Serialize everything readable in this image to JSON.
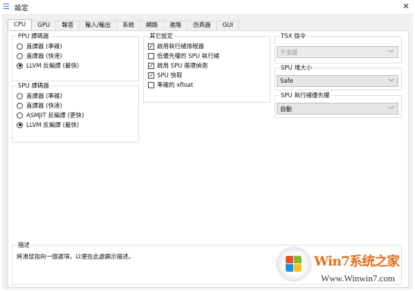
{
  "window": {
    "title": "設定",
    "close": "✕"
  },
  "tabs": [
    "CPU",
    "GPU",
    "聲音",
    "輸入/輸出",
    "系統",
    "網路",
    "進階",
    "仿真器",
    "GUI"
  ],
  "ppu": {
    "label": "PPU 譯碼器",
    "options": [
      "直譯器 (準確)",
      "直譯器 (快速)",
      "LLVM 反編譯 (最快)"
    ],
    "selected": 2
  },
  "spu": {
    "label": "SPU 譯碼器",
    "options": [
      "直譯器 (準確)",
      "直譯器 (快速)",
      "ASMJIT 反編譯 (更快)",
      "LLVM 反編譯 (最快)"
    ],
    "selected": 3
  },
  "other": {
    "label": "其它設定",
    "items": [
      {
        "label": "啟用執行緒排程器",
        "checked": true
      },
      {
        "label": "低優先權的 SPU 執行緒",
        "checked": false
      },
      {
        "label": "啟用 SPU 循環偵測",
        "checked": true
      },
      {
        "label": "SPU 快取",
        "checked": true
      },
      {
        "label": "準確的 xfloat",
        "checked": false
      }
    ]
  },
  "tsx": {
    "label": "TSX 指令",
    "value": "不支援"
  },
  "spu_block": {
    "label": "SPU 塊大小",
    "value": "Safe"
  },
  "spu_priority": {
    "label": "SPU 執行緒優先權",
    "value": "自動"
  },
  "description": {
    "label": "描述",
    "text": "將滑鼠指向一個選項，以便在此處顯示描述。"
  },
  "watermark": {
    "brand": "Win7系统之家",
    "url": "Www.Winwin7.com"
  }
}
